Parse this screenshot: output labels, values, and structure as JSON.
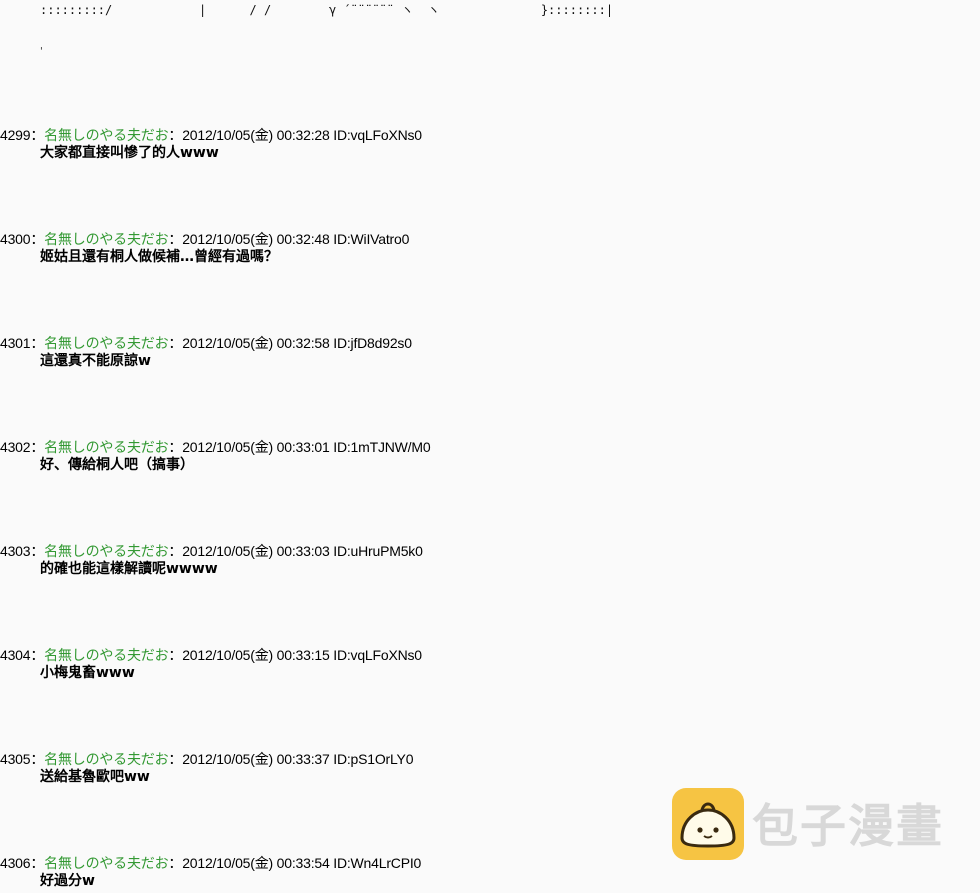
{
  "ascii_art": {
    "line": ":::::::::/            |      / /        γ ´¨¨¨¨¨¨ ヽ  ヽ              }::::::::|",
    "dot": "'"
  },
  "posts": [
    {
      "number": "4299",
      "sep": "：",
      "name": "名無しのやる夫だお",
      "sep2": "：",
      "meta": "2012/10/05(金) 00:32:28 ID:vqLFoXNs0",
      "message": "大家都直接叫慘了的人www"
    },
    {
      "number": "4300",
      "sep": "：",
      "name": "名無しのやる夫だお",
      "sep2": "：",
      "meta": "2012/10/05(金) 00:32:48 ID:WiIVatro0",
      "message": "姬姑且還有桐人做候補…曾經有過嗎？"
    },
    {
      "number": "4301",
      "sep": "：",
      "name": "名無しのやる夫だお",
      "sep2": "：",
      "meta": "2012/10/05(金) 00:32:58 ID:jfD8d92s0",
      "message": "這還真不能原諒w"
    },
    {
      "number": "4302",
      "sep": "：",
      "name": "名無しのやる夫だお",
      "sep2": "：",
      "meta": "2012/10/05(金) 00:33:01 ID:1mTJNW/M0",
      "message": "好、傳給桐人吧（搞事）"
    },
    {
      "number": "4303",
      "sep": "：",
      "name": "名無しのやる夫だお",
      "sep2": "：",
      "meta": "2012/10/05(金) 00:33:03 ID:uHruPM5k0",
      "message": "的確也能這樣解讀呢wwww"
    },
    {
      "number": "4304",
      "sep": "：",
      "name": "名無しのやる夫だお",
      "sep2": "：",
      "meta": "2012/10/05(金) 00:33:15 ID:vqLFoXNs0",
      "message": "小梅鬼畜www"
    },
    {
      "number": "4305",
      "sep": "：",
      "name": "名無しのやる夫だお",
      "sep2": "：",
      "meta": "2012/10/05(金) 00:33:37 ID:pS1OrLY0",
      "message": "送給基魯歐吧ww"
    },
    {
      "number": "4306",
      "sep": "：",
      "name": "名無しのやる夫だお",
      "sep2": "：",
      "meta": "2012/10/05(金) 00:33:54 ID:Wn4LrCPI0",
      "message": "好過分w"
    }
  ],
  "watermark": {
    "text": "包子漫畫",
    "icon": "bun-icon",
    "icon_color": "#f6c443"
  }
}
